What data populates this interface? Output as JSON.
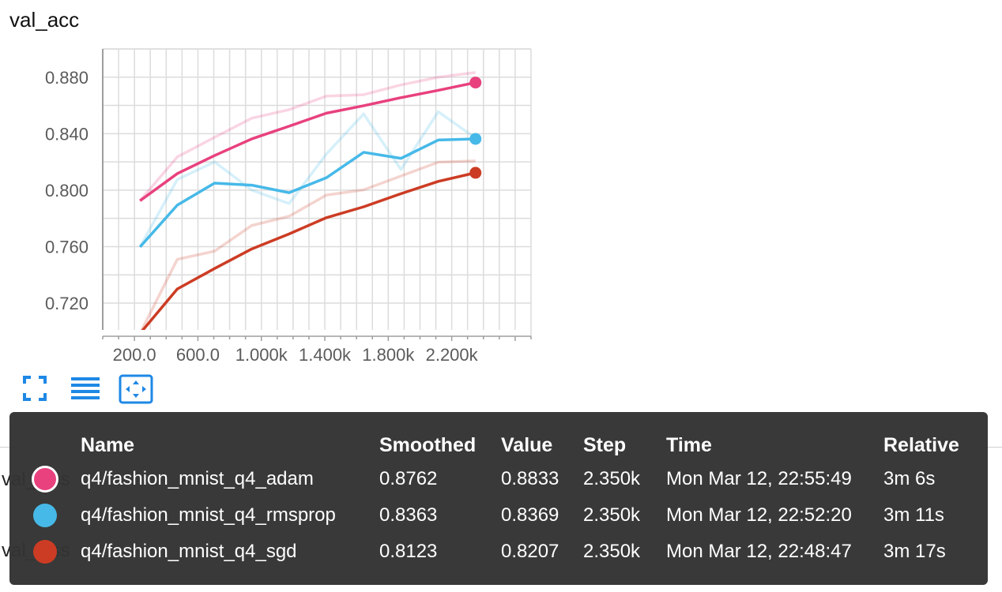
{
  "chart_title": "val_acc",
  "background": {
    "partial_label_1": "val_loss",
    "partial_label_2": "val_loss"
  },
  "toolbar": {
    "fullscreen_icon": "expand-icon",
    "data_table_icon": "lines-icon",
    "fit_domain_icon": "fit-domain-icon"
  },
  "chart_data": {
    "type": "line",
    "title": "val_acc",
    "xlabel": "",
    "ylabel": "",
    "xlim": [
      0,
      2700
    ],
    "ylim": [
      0.701,
      0.9
    ],
    "x_ticks": [
      200,
      600,
      1000,
      1400,
      1800,
      2200
    ],
    "x_tick_labels": [
      "200.0",
      "600.0",
      "1.000k",
      "1.400k",
      "1.800k",
      "2.200k"
    ],
    "y_ticks": [
      0.72,
      0.76,
      0.8,
      0.84,
      0.88
    ],
    "y_tick_labels": [
      "0.720",
      "0.760",
      "0.800",
      "0.840",
      "0.880"
    ],
    "grid": true,
    "x": [
      235,
      470,
      705,
      940,
      1175,
      1410,
      1645,
      1880,
      2115,
      2350
    ],
    "series": [
      {
        "name": "q4/fashion_mnist_q4_adam",
        "color": "#e8417e",
        "smoothed": [
          0.7925,
          0.8117,
          0.8245,
          0.8363,
          0.8453,
          0.8545,
          0.8598,
          0.8655,
          0.8707,
          0.8762
        ],
        "raw": [
          0.7925,
          0.8235,
          0.8374,
          0.851,
          0.857,
          0.8666,
          0.8676,
          0.8745,
          0.88,
          0.8833
        ]
      },
      {
        "name": "q4/fashion_mnist_q4_rmsprop",
        "color": "#46b9e8",
        "smoothed": [
          0.7598,
          0.7894,
          0.805,
          0.8035,
          0.7982,
          0.8088,
          0.8268,
          0.8225,
          0.8355,
          0.8363
        ],
        "raw": [
          0.7598,
          0.8075,
          0.82,
          0.8,
          0.7905,
          0.8256,
          0.854,
          0.8146,
          0.8555,
          0.8369
        ]
      },
      {
        "name": "q4/fashion_mnist_q4_sgd",
        "color": "#cc3c24",
        "smoothed": [
          0.6985,
          0.73,
          0.7445,
          0.7584,
          0.769,
          0.7805,
          0.7882,
          0.7975,
          0.8062,
          0.8123
        ],
        "raw": [
          0.6985,
          0.751,
          0.7568,
          0.775,
          0.7815,
          0.7965,
          0.8002,
          0.81,
          0.8198,
          0.8207
        ]
      }
    ]
  },
  "tooltip": {
    "headers": {
      "name": "Name",
      "smoothed": "Smoothed",
      "value": "Value",
      "step": "Step",
      "time": "Time",
      "relative": "Relative"
    },
    "rows": [
      {
        "color": "#e8417e",
        "selected": true,
        "name": "q4/fashion_mnist_q4_adam",
        "smoothed": "0.8762",
        "value": "0.8833",
        "step": "2.350k",
        "time": "Mon Mar 12, 22:55:49",
        "relative": "3m 6s"
      },
      {
        "color": "#46b9e8",
        "selected": false,
        "name": "q4/fashion_mnist_q4_rmsprop",
        "smoothed": "0.8363",
        "value": "0.8369",
        "step": "2.350k",
        "time": "Mon Mar 12, 22:52:20",
        "relative": "3m 11s"
      },
      {
        "color": "#cc3c24",
        "selected": false,
        "name": "q4/fashion_mnist_q4_sgd",
        "smoothed": "0.8123",
        "value": "0.8207",
        "step": "2.350k",
        "time": "Mon Mar 12, 22:48:47",
        "relative": "3m 17s"
      }
    ]
  }
}
